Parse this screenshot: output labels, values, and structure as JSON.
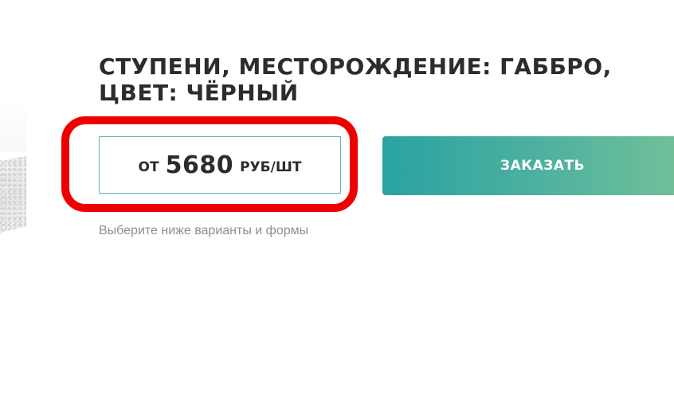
{
  "product": {
    "title_line1": "СТУПЕНИ, МЕСТОРОЖДЕНИЕ: ГАББРО,",
    "title_line2": "ЦВЕТ: ЧЁРНЫЙ",
    "price_prefix": "ОТ",
    "price_value": "5680",
    "price_unit": "РУБ/ШТ",
    "hint": "Выберите ниже варианты и формы"
  },
  "actions": {
    "order_label": "ЗАКАЗАТЬ"
  },
  "colors": {
    "accent_start": "#2aa3a2",
    "accent_end": "#72c198",
    "price_border": "#5db7b5",
    "highlight": "#ee0000"
  }
}
